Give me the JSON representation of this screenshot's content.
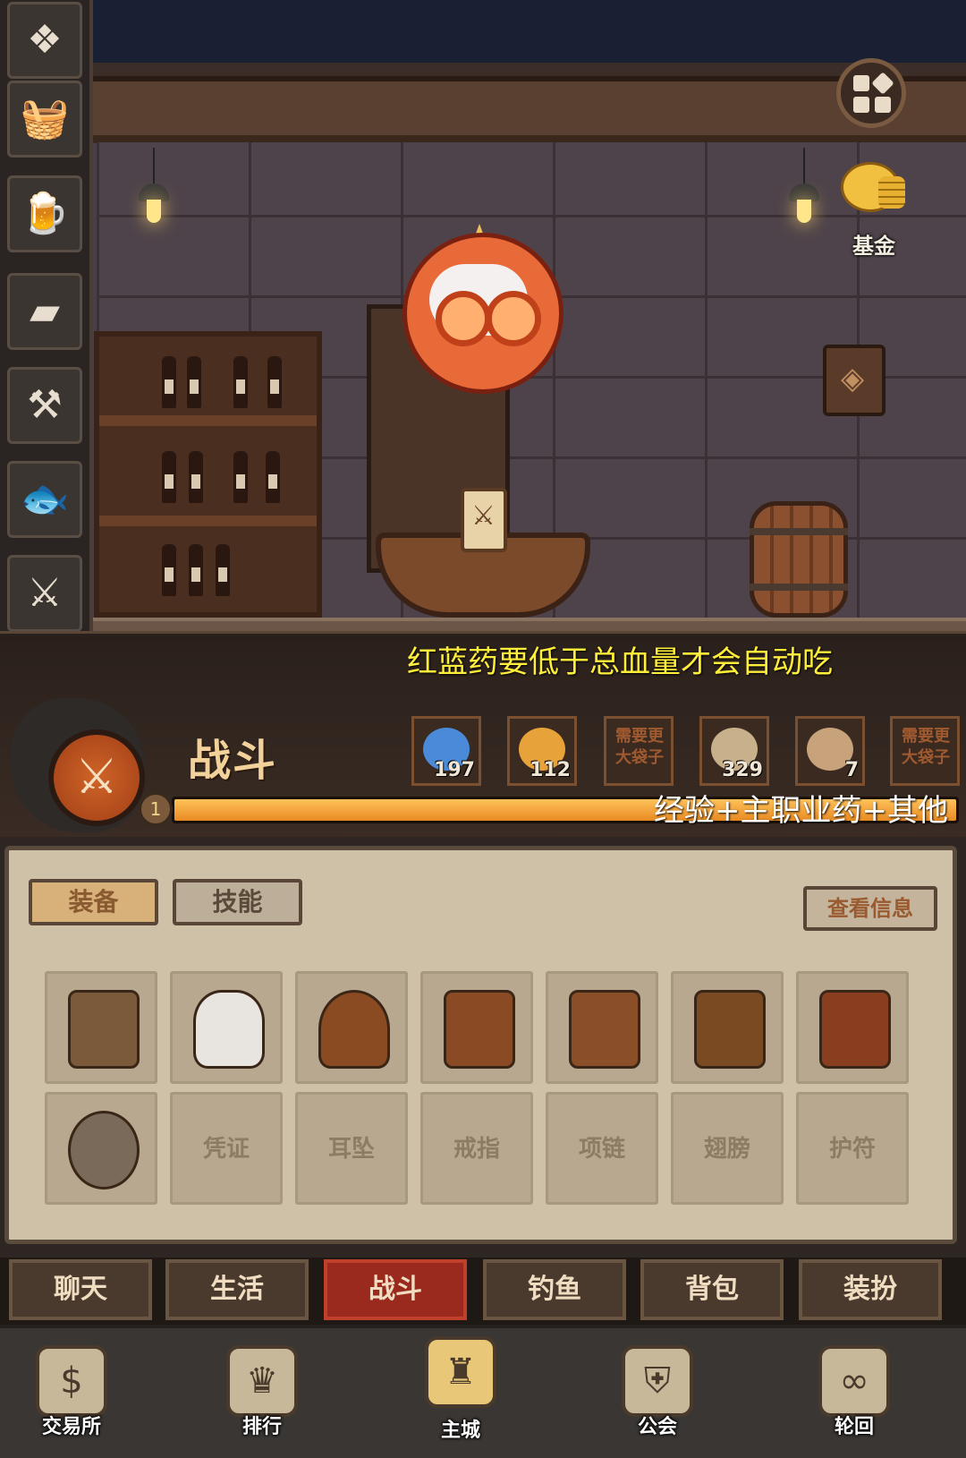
{
  "sidebar": {
    "items": [
      {
        "icon": "knot-emblem-icon",
        "glyph": "❖"
      },
      {
        "icon": "food-basket-icon",
        "glyph": "🧺"
      },
      {
        "icon": "beer-mug-icon",
        "glyph": "🍺"
      },
      {
        "icon": "gold-bars-icon",
        "glyph": "▰"
      },
      {
        "icon": "hammer-icon",
        "glyph": "⚒"
      },
      {
        "icon": "fish-icon",
        "glyph": "🐟"
      },
      {
        "icon": "crossed-swords-icon",
        "glyph": "⚔"
      }
    ]
  },
  "top_right": {
    "menu_icon": "grid-menu-icon",
    "fund_label": "基金",
    "fund_icon": "piggy-bank-coins-icon"
  },
  "overlay_notes": {
    "tip_top": "红蓝药要低于总血量才会自动吃",
    "tip_bottom": "经验+主职业药+其他"
  },
  "status": {
    "mode_title": "战斗",
    "level": "1",
    "xp_fraction": 1.0,
    "slots": [
      {
        "icon": "blue-potion-icon",
        "count": "197",
        "color": "#4a8ad8"
      },
      {
        "icon": "orange-pie-icon",
        "count": "112",
        "color": "#e8a23a"
      },
      {
        "need_text": "需要更大袋子"
      },
      {
        "icon": "exp-scroll-icon",
        "count": "329",
        "color": "#c8b08a"
      },
      {
        "icon": "class-potion-icon",
        "count": "7",
        "color": "#c8a27a"
      },
      {
        "need_text": "需要更大袋子"
      }
    ]
  },
  "panel": {
    "tabs": [
      "装备",
      "技能"
    ],
    "info_button": "查看信息",
    "slots_row1": [
      {
        "icon": "crossbow-icon"
      },
      {
        "icon": "cloth-bag-icon"
      },
      {
        "icon": "feathered-hat-icon"
      },
      {
        "icon": "leather-bracer-icon"
      },
      {
        "icon": "leather-vest-icon"
      },
      {
        "icon": "leather-shorts-icon"
      },
      {
        "icon": "leather-boot-icon"
      }
    ],
    "slots_row2": [
      {
        "icon": "medallion-icon",
        "label": ""
      },
      {
        "label": "凭证"
      },
      {
        "label": "耳坠"
      },
      {
        "label": "戒指"
      },
      {
        "label": "项链"
      },
      {
        "label": "翅膀"
      },
      {
        "label": "护符"
      }
    ]
  },
  "bottom_tabs": [
    "聊天",
    "生活",
    "战斗",
    "钓鱼",
    "背包",
    "装扮"
  ],
  "active_tab": "战斗",
  "nav": [
    {
      "label": "交易所",
      "icon": "money-bag-icon",
      "glyph": "$"
    },
    {
      "label": "排行",
      "icon": "trophy-icon",
      "glyph": "♛"
    },
    {
      "label": "主城",
      "icon": "castle-icon",
      "glyph": "♜"
    },
    {
      "label": "公会",
      "icon": "guild-shield-icon",
      "glyph": "⛨"
    },
    {
      "label": "轮回",
      "icon": "infinity-icon",
      "glyph": "∞"
    }
  ],
  "colors": {
    "tip_yellow": "#ffee3a",
    "xp_orange": "#e88a22",
    "active_tab_red": "#9a2a1e"
  }
}
